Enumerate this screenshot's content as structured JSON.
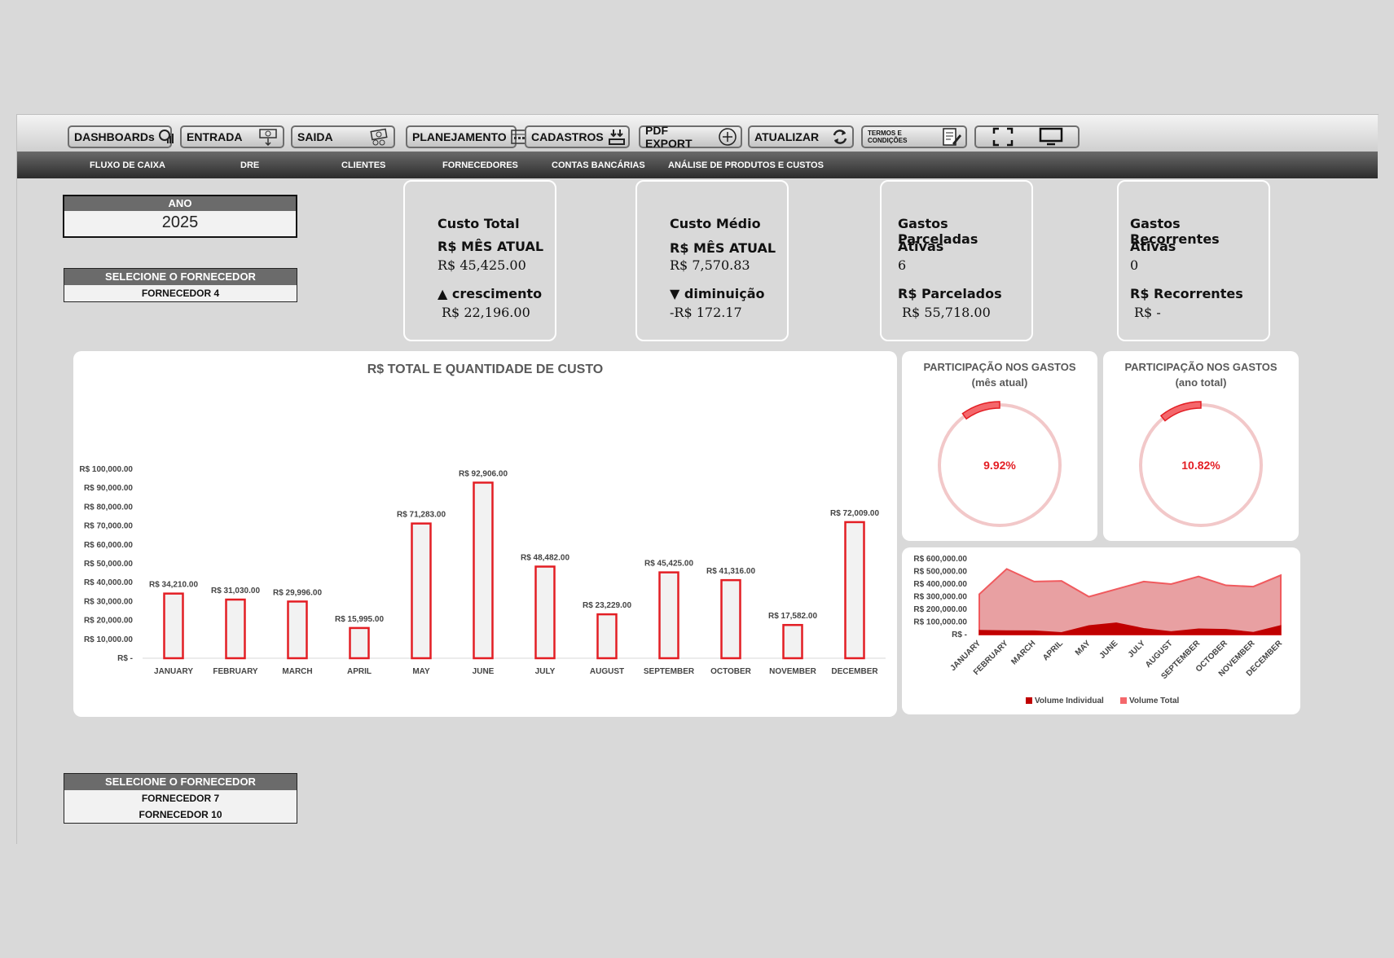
{
  "toolbar": {
    "buttons": [
      {
        "label": "DASHBOARDs",
        "icon": "dashboard-icon"
      },
      {
        "label": "ENTRADA",
        "icon": "money-in-icon"
      },
      {
        "label": "SAIDA",
        "icon": "money-out-icon"
      },
      {
        "label": "PLANEJAMENTO",
        "icon": "planning-icon"
      },
      {
        "label": "CADASTROS",
        "icon": "register-icon"
      },
      {
        "label": "PDF EXPORT",
        "icon": "add-circle-icon"
      },
      {
        "label": "ATUALIZAR",
        "icon": "refresh-icon"
      },
      {
        "label": "TERMOS E CONDIÇÕES",
        "icon": "contract-icon"
      }
    ],
    "fullscreen_icon": "fullscreen-icon",
    "monitor_icon": "monitor-icon"
  },
  "subnav": [
    "FLUXO DE CAIXA",
    "DRE",
    "CLIENTES",
    "FORNECEDORES",
    "CONTAS BANCÁRIAS",
    "ANÁLISE DE PRODUTOS E CUSTOS"
  ],
  "ano": {
    "label": "ANO",
    "value": "2025"
  },
  "fornecedor_top": {
    "label": "SELECIONE O FORNECEDOR",
    "value": "FORNECEDOR 4"
  },
  "fornecedor_bottom": {
    "label": "SELECIONE O FORNECEDOR",
    "values": [
      "FORNECEDOR 7",
      "FORNECEDOR 10"
    ]
  },
  "kpis": [
    {
      "l1": "Custo Total",
      "l2": "R$ MÊS ATUAL",
      "v1": "R$ 45,425.00",
      "l3": "▲ crescimento",
      "v2": "R$ 22,196.00"
    },
    {
      "l1": "Custo Médio",
      "l2": "R$ MÊS ATUAL",
      "v1": "R$ 7,570.83",
      "l3": "▼ diminuição",
      "v2": "-R$ 172.17"
    },
    {
      "l1": "Gastos Parceladas",
      "l2": "Ativas",
      "v1": "6",
      "l3": "R$ Parcelados",
      "v2": "R$ 55,718.00"
    },
    {
      "l1": "Gastos Recorrentes",
      "l2": "Ativas",
      "v1": "0",
      "l3": "R$ Recorrentes",
      "v2": "R$ -"
    }
  ],
  "colors": {
    "accent": "#e31e24",
    "light_red": "#e8a0a2",
    "dark_red": "#c00000",
    "ring": "#f2c8c9"
  },
  "donuts": [
    {
      "title1": "PARTICIPAÇÃO NOS GASTOS",
      "title2": "(mês atual)",
      "value": "9.92%",
      "fraction": 0.0992
    },
    {
      "title1": "PARTICIPAÇÃO NOS GASTOS",
      "title2": "(ano total)",
      "value": "10.82%",
      "fraction": 0.1082
    }
  ],
  "chart_data": [
    {
      "type": "bar",
      "title": "R$ TOTAL E QUANTIDADE DE CUSTO",
      "categories": [
        "JANUARY",
        "FEBRUARY",
        "MARCH",
        "APRIL",
        "MAY",
        "JUNE",
        "JULY",
        "AUGUST",
        "SEPTEMBER",
        "OCTOBER",
        "NOVEMBER",
        "DECEMBER"
      ],
      "values": [
        34210,
        31030,
        29996,
        15995,
        71283,
        92906,
        48482,
        23229,
        45425,
        41316,
        17582,
        72009
      ],
      "value_labels": [
        "R$ 34,210.00",
        "R$ 31,030.00",
        "R$ 29,996.00",
        "R$ 15,995.00",
        "R$ 71,283.00",
        "R$ 92,906.00",
        "R$ 48,482.00",
        "R$ 23,229.00",
        "R$ 45,425.00",
        "R$ 41,316.00",
        "R$ 17,582.00",
        "R$ 72,009.00"
      ],
      "ylim": [
        0,
        100000
      ],
      "yticks": [
        "R$ -",
        "R$ 10,000.00",
        "R$ 20,000.00",
        "R$ 30,000.00",
        "R$ 40,000.00",
        "R$ 50,000.00",
        "R$ 60,000.00",
        "R$ 70,000.00",
        "R$ 80,000.00",
        "R$ 90,000.00",
        "R$ 100,000.00"
      ],
      "grid": false
    },
    {
      "type": "area",
      "categories": [
        "JANUARY",
        "FEBRUARY",
        "MARCH",
        "APRIL",
        "MAY",
        "JUNE",
        "JULY",
        "AUGUST",
        "SEPTEMBER",
        "OCTOBER",
        "NOVEMBER",
        "DECEMBER"
      ],
      "series": [
        {
          "name": "Volume Total",
          "values": [
            320000,
            520000,
            420000,
            425000,
            300000,
            360000,
            420000,
            400000,
            460000,
            390000,
            380000,
            470000
          ]
        },
        {
          "name": "Volume Individual",
          "values": [
            34210,
            31030,
            29996,
            15995,
            71283,
            92906,
            48482,
            23229,
            45425,
            41316,
            17582,
            72009
          ]
        }
      ],
      "ylim": [
        0,
        600000
      ],
      "yticks": [
        "R$ -",
        "R$ 100,000.00",
        "R$ 200,000.00",
        "R$ 300,000.00",
        "R$ 400,000.00",
        "R$ 500,000.00",
        "R$ 600,000.00"
      ],
      "legend": "bottom"
    }
  ]
}
